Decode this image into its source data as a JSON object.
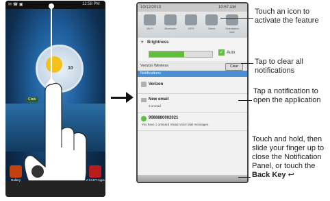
{
  "left_phone": {
    "status_time": "12:58 PM",
    "clock_time": "10",
    "weather_label": "Clark",
    "dock_apps": [
      "Gallery",
      "",
      "",
      "V CAST Apps"
    ]
  },
  "right_phone": {
    "status_date": "10/12/2010",
    "status_time": "10:57 AM",
    "toggles": [
      "Wi-Fi",
      "Bluetooth",
      "GPS",
      "Silent",
      "Orientation lock"
    ],
    "brightness_label": "Brightness",
    "brightness_level": 0.55,
    "auto_label": "Auto",
    "carrier": "Verizon Wireless",
    "clear_label": "Clear",
    "notifications_header": "Notifications",
    "notifications": [
      {
        "title": "Verizon",
        "subtitle": ""
      },
      {
        "title": "New email",
        "subtitle": "3 unread"
      },
      {
        "title": "9088880002021",
        "subtitle": "You have 1 unheard Visual Voice Mail messages."
      }
    ]
  },
  "callouts": {
    "touch_icon": "Touch an icon to activate the feature",
    "clear_all": "Tap to clear all notifications",
    "open_app": "Tap a notification to open the application",
    "close_panel": "Touch and hold, then slide your finger up to close the Notification Panel, or touch the",
    "back_key": "Back Key"
  },
  "colors": {
    "accent_blue": "#4a8fd3",
    "brightness_green": "#5fbf3a"
  }
}
